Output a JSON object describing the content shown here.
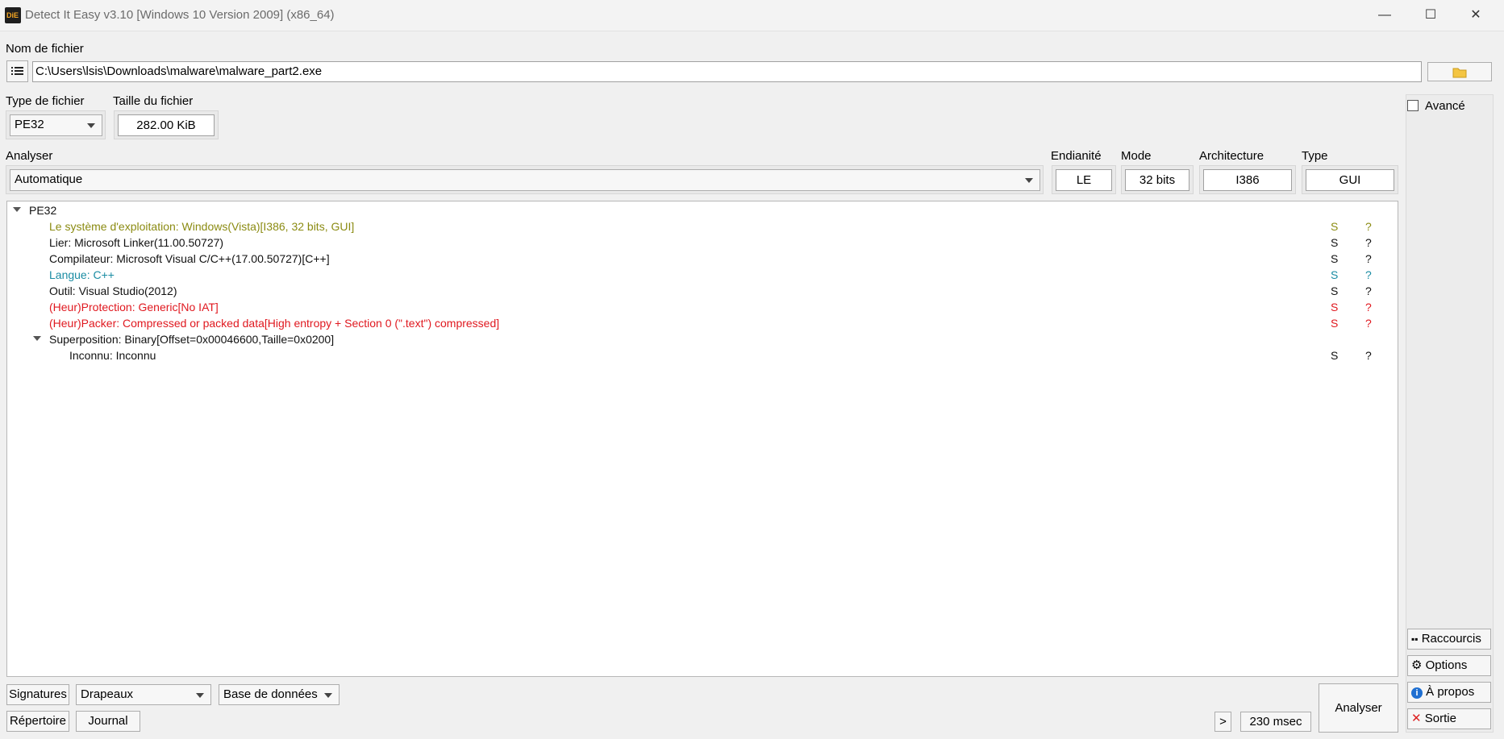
{
  "window": {
    "title": "Detect It Easy v3.10 [Windows 10 Version 2009] (x86_64)",
    "app_icon_text": "DiE",
    "minimize": "—",
    "maximize": "☐",
    "close": "✕"
  },
  "file": {
    "label": "Nom de fichier",
    "path": "C:\\Users\\lsis\\Downloads\\malware\\malware_part2.exe",
    "list_icon": "list-icon",
    "open_icon": "folder-icon"
  },
  "file_type": {
    "label": "Type de fichier",
    "value": "PE32"
  },
  "file_size": {
    "label": "Taille du fichier",
    "value": "282.00 KiB"
  },
  "advanced": {
    "label": "Avancé",
    "checked": false
  },
  "scan": {
    "label": "Analyser",
    "value": "Automatique"
  },
  "endianness": {
    "label": "Endianité",
    "value": "LE"
  },
  "mode": {
    "label": "Mode",
    "value": "32 bits"
  },
  "architecture": {
    "label": "Architecture",
    "value": "I386"
  },
  "type": {
    "label": "Type",
    "value": "GUI"
  },
  "tree": {
    "root": "PE32",
    "items": [
      {
        "text": "Le système d'exploitation: Windows(Vista)[I386, 32 bits, GUI]",
        "s": "S",
        "q": "?",
        "color": "#8b8b12"
      },
      {
        "text": "Lier: Microsoft Linker(11.00.50727)",
        "s": "S",
        "q": "?",
        "color": "#111111"
      },
      {
        "text": "Compilateur: Microsoft Visual C/C++(17.00.50727)[C++]",
        "s": "S",
        "q": "?",
        "color": "#111111"
      },
      {
        "text": "Langue: C++",
        "s": "S",
        "q": "?",
        "color": "#1a8ca3"
      },
      {
        "text": "Outil: Visual Studio(2012)",
        "s": "S",
        "q": "?",
        "color": "#111111"
      },
      {
        "text": "(Heur)Protection: Generic[No IAT]",
        "s": "S",
        "q": "?",
        "color": "#e0181f"
      },
      {
        "text": "(Heur)Packer: Compressed or packed data[High entropy + Section 0 (\".text\") compressed]",
        "s": "S",
        "q": "?",
        "color": "#e0181f"
      }
    ],
    "overlay": "Superposition: Binary[Offset=0x00046600,Taille=0x0200]",
    "overlay_child": {
      "text": "Inconnu: Inconnu",
      "s": "S",
      "q": "?"
    }
  },
  "bottom": {
    "signatures": "Signatures",
    "flags": "Drapeaux",
    "database": "Base de données",
    "directory": "Répertoire",
    "log": "Journal",
    "more": ">",
    "time": "230 msec",
    "analyze": "Analyser"
  },
  "side": {
    "shortcuts": "Raccourcis",
    "options": "Options",
    "about": "À propos",
    "exit": "Sortie"
  }
}
